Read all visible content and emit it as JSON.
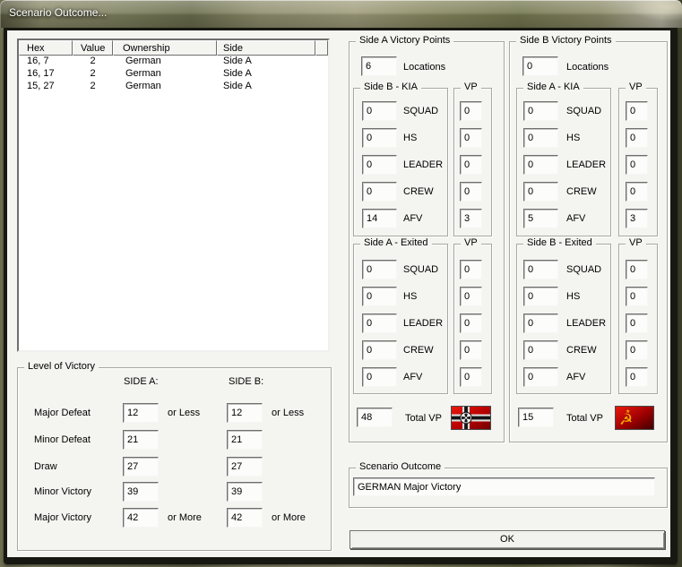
{
  "window": {
    "title": "Scenario Outcome..."
  },
  "locations_table": {
    "columns": [
      "Hex",
      "Value",
      "Ownership",
      "Side"
    ],
    "rows": [
      {
        "hex": "16, 7",
        "value": "2",
        "ownership": "German",
        "side": "Side A"
      },
      {
        "hex": "16, 17",
        "value": "2",
        "ownership": "German",
        "side": "Side A"
      },
      {
        "hex": "15, 27",
        "value": "2",
        "ownership": "German",
        "side": "Side A"
      }
    ]
  },
  "level_of_victory": {
    "title": "Level of Victory",
    "side_a_header": "SIDE A:",
    "side_b_header": "SIDE B:",
    "rows": [
      {
        "label": "Major Defeat",
        "side_a": "12",
        "side_a_suffix": "or Less",
        "side_b": "12",
        "side_b_suffix": "or Less"
      },
      {
        "label": "Minor Defeat",
        "side_a": "21",
        "side_a_suffix": "",
        "side_b": "21",
        "side_b_suffix": ""
      },
      {
        "label": "Draw",
        "side_a": "27",
        "side_a_suffix": "",
        "side_b": "27",
        "side_b_suffix": ""
      },
      {
        "label": "Minor Victory",
        "side_a": "39",
        "side_a_suffix": "",
        "side_b": "39",
        "side_b_suffix": ""
      },
      {
        "label": "Major Victory",
        "side_a": "42",
        "side_a_suffix": "or More",
        "side_b": "42",
        "side_b_suffix": "or More"
      }
    ]
  },
  "side_a_panel": {
    "title": "Side A Victory Points",
    "locations_value": "6",
    "locations_label": "Locations",
    "kia": {
      "title": "Side B - KIA",
      "vp_title": "VP",
      "rows": [
        {
          "label": "SQUAD",
          "count": "0",
          "vp": "0"
        },
        {
          "label": "HS",
          "count": "0",
          "vp": "0"
        },
        {
          "label": "LEADER",
          "count": "0",
          "vp": "0"
        },
        {
          "label": "CREW",
          "count": "0",
          "vp": "0"
        },
        {
          "label": "AFV",
          "count": "14",
          "vp": "3"
        }
      ]
    },
    "exited": {
      "title": "Side A - Exited",
      "vp_title": "VP",
      "rows": [
        {
          "label": "SQUAD",
          "count": "0",
          "vp": "0"
        },
        {
          "label": "HS",
          "count": "0",
          "vp": "0"
        },
        {
          "label": "LEADER",
          "count": "0",
          "vp": "0"
        },
        {
          "label": "CREW",
          "count": "0",
          "vp": "0"
        },
        {
          "label": "AFV",
          "count": "0",
          "vp": "0"
        }
      ]
    },
    "total_value": "48",
    "total_label": "Total VP",
    "flag": "german-war-flag"
  },
  "side_b_panel": {
    "title": "Side B Victory Points",
    "locations_value": "0",
    "locations_label": "Locations",
    "kia": {
      "title": "Side A - KIA",
      "vp_title": "VP",
      "rows": [
        {
          "label": "SQUAD",
          "count": "0",
          "vp": "0"
        },
        {
          "label": "HS",
          "count": "0",
          "vp": "0"
        },
        {
          "label": "LEADER",
          "count": "0",
          "vp": "0"
        },
        {
          "label": "CREW",
          "count": "0",
          "vp": "0"
        },
        {
          "label": "AFV",
          "count": "5",
          "vp": "3"
        }
      ]
    },
    "exited": {
      "title": "Side B - Exited",
      "vp_title": "VP",
      "rows": [
        {
          "label": "SQUAD",
          "count": "0",
          "vp": "0"
        },
        {
          "label": "HS",
          "count": "0",
          "vp": "0"
        },
        {
          "label": "LEADER",
          "count": "0",
          "vp": "0"
        },
        {
          "label": "CREW",
          "count": "0",
          "vp": "0"
        },
        {
          "label": "AFV",
          "count": "0",
          "vp": "0"
        }
      ]
    },
    "total_value": "15",
    "total_label": "Total VP",
    "flag": "soviet-flag"
  },
  "scenario_outcome": {
    "title": "Scenario Outcome",
    "value": "GERMAN Major Victory"
  },
  "ok_button_label": "OK",
  "colors": {
    "german_flag_red": "#c00000",
    "soviet_flag_red": "#c00000",
    "soviet_emblem_gold": "#f0b400",
    "dialog_background": "#f4f4f1"
  }
}
